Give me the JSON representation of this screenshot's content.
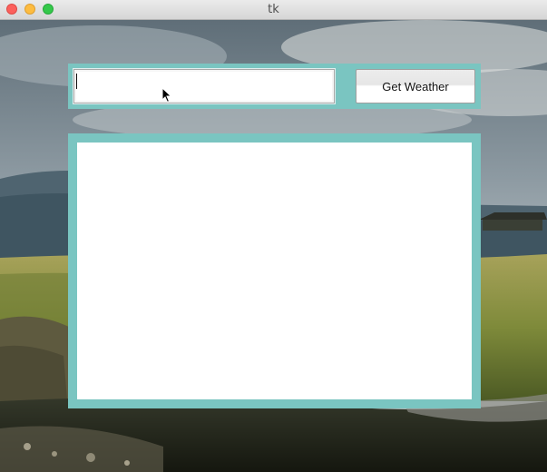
{
  "window": {
    "title": "tk",
    "traffic_lights": {
      "close_color": "#fc605c",
      "minimize_color": "#fdbc40",
      "maximize_color": "#34c84a"
    }
  },
  "colors": {
    "frame_accent": "#7ac5c1",
    "panel_background": "#ffffff"
  },
  "search": {
    "value": "",
    "placeholder": ""
  },
  "weather_button": {
    "label": "Get Weather"
  },
  "results": {
    "text": ""
  },
  "background": {
    "description": "",
    "icon": "landscape-photo"
  },
  "cursor": {
    "icon": "mouse-pointer-icon"
  }
}
